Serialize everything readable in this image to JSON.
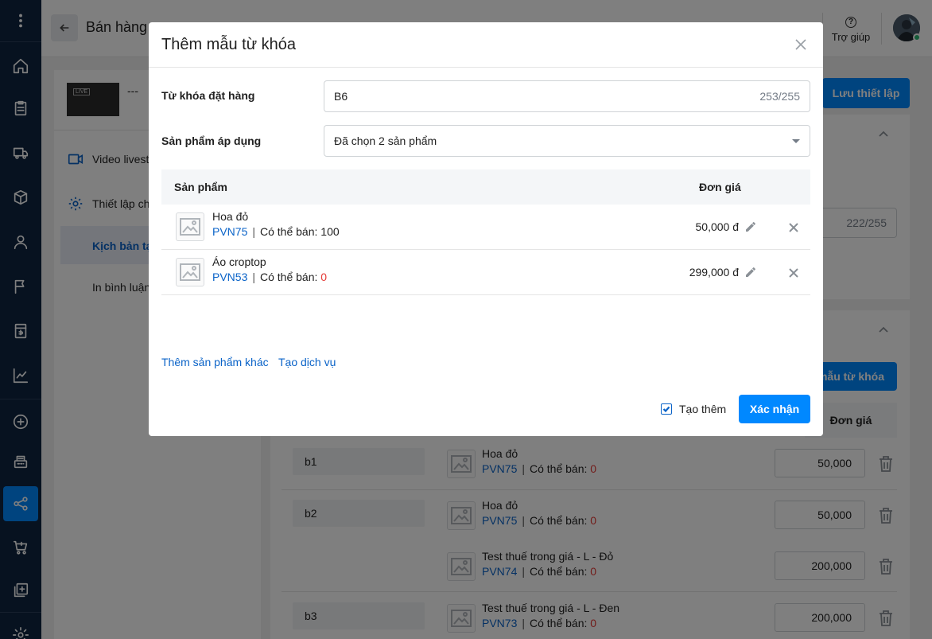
{
  "header": {
    "page_title": "Bán hàng",
    "help_label": "Trợ giúp"
  },
  "sidebar": {
    "thumb_badge": "LIVE",
    "stream_name": "---",
    "items": [
      {
        "label": "Video livest"
      },
      {
        "label": "Thiết lập ch"
      },
      {
        "label": "Kịch bản tạ"
      },
      {
        "label": "In bình luận"
      }
    ]
  },
  "main": {
    "save_label": "Lưu thiết lập",
    "counter": "222/255",
    "add_template_label": "mẫu từ khóa",
    "price_col": "Đơn giá",
    "rows": [
      {
        "keyword": "b1",
        "products": [
          {
            "name": "Hoa đỏ",
            "sku": "PVN75",
            "stock_label": "Có thể bán:",
            "stock": "0",
            "price": "50,000"
          }
        ]
      },
      {
        "keyword": "b2",
        "products": [
          {
            "name": "Hoa đỏ",
            "sku": "PVN75",
            "stock_label": "Có thể bán:",
            "stock": "0",
            "price": "50,000"
          },
          {
            "name": "Test thuế trong giá - L - Đỏ",
            "sku": "PVN74",
            "stock_label": "Có thể bán:",
            "stock": "0",
            "price": "200,000"
          }
        ]
      },
      {
        "keyword": "b3",
        "products": [
          {
            "name": "Test thuế trong giá - L - Đen",
            "sku": "PVN73",
            "stock_label": "Có thể bán:",
            "stock": "0",
            "price": "200,000"
          }
        ]
      }
    ]
  },
  "modal": {
    "title": "Thêm mẫu từ khóa",
    "keyword_label": "Từ khóa đặt hàng",
    "keyword_value": "B6",
    "keyword_counter": "253/255",
    "product_label": "Sản phẩm áp dụng",
    "product_select_value": "Đã chọn 2 sản phẩm",
    "table": {
      "col_product": "Sản phẩm",
      "col_price": "Đơn giá",
      "rows": [
        {
          "name": "Hoa đỏ",
          "sku": "PVN75",
          "stock_label": "Có thể bán:",
          "stock": "100",
          "stock_zero": false,
          "price": "50,000 đ"
        },
        {
          "name": "Áo croptop",
          "sku": "PVN53",
          "stock_label": "Có thể bán:",
          "stock": "0",
          "stock_zero": true,
          "price": "299,000 đ"
        }
      ]
    },
    "link_add_product": "Thêm sản phẩm khác",
    "link_create_service": "Tạo dịch vụ",
    "create_more_label": "Tạo thêm",
    "create_more_checked": true,
    "confirm_label": "Xác nhận"
  },
  "colors": {
    "accent": "#0088ff",
    "link": "#0a63c8",
    "nav_bg": "#0f2540",
    "zero_stock": "#e53935"
  }
}
